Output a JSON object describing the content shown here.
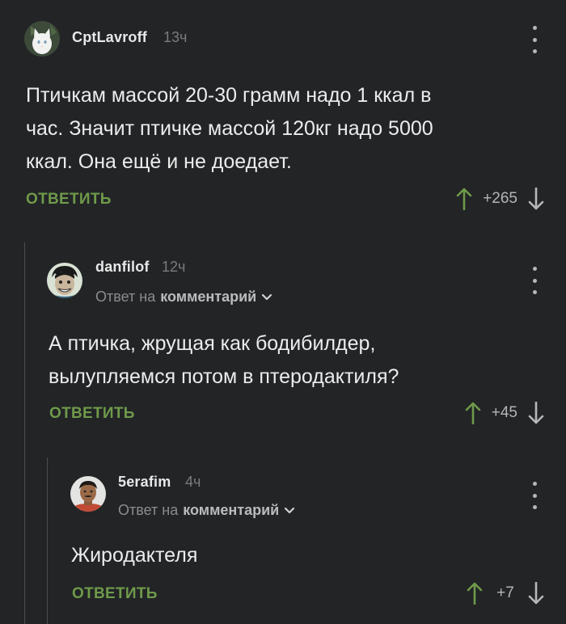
{
  "comments": [
    {
      "username": "CptLavroff",
      "time": "13ч",
      "text_lines": [
        "Птичкам массой 20-30 грамм надо 1 ккал в",
        "час. Значит птичке массой 120кг надо 5000",
        "ккал. Она ещё и не доедает."
      ],
      "reply_label": "ОТВЕТИТЬ",
      "score": "+265",
      "avatar": "white-cat-avatar"
    },
    {
      "username": "danfilof",
      "time": "12ч",
      "reply_to_prefix": "Ответ на",
      "reply_to_target": "комментарий",
      "text_lines": [
        "А птичка, жрущая как бодибилдер,",
        "вылупляемся потом в птеродактиля?"
      ],
      "reply_label": "ОТВЕТИТЬ",
      "score": "+45",
      "avatar": "cartoon-face-avatar"
    },
    {
      "username": "5erafim",
      "time": "4ч",
      "reply_to_prefix": "Ответ на",
      "reply_to_target": "комментарий",
      "text_lines": [
        "Жиродактеля"
      ],
      "reply_label": "ОТВЕТИТЬ",
      "score": "+7",
      "avatar": "man-portrait-avatar"
    }
  ],
  "icons": {
    "upvote": "arrow-up-icon",
    "downvote": "arrow-down-icon",
    "menu": "more-vertical-icon",
    "chevron": "chevron-down-icon"
  },
  "colors": {
    "background": "#222426",
    "reply_green": "#6f9a4a",
    "upvote_green": "#6f9a4a",
    "text": "#ececec",
    "muted": "#7a7c7e"
  }
}
